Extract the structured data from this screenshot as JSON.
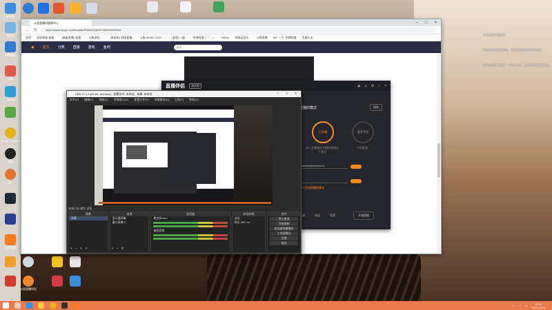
{
  "browser": {
    "tab_label": "斗鱼直播间管理中心",
    "url": "https://www.douyu.com/founder/Partner/Q4H/7/0023/2/0/2/0/6",
    "bookmarks": [
      "应用",
      "导航频道 极速...",
      "(高级直播) 极速...",
      "斗鱼游戏 - ...",
      "(发起的) 刚刚直播...",
      "斗鱼-MOBA 2345 - ...",
      "(游戏) 一起...",
      "哔哩哔哩 (゜-゜)...",
      "GitHub",
      "网易云音乐...",
      "斗鱼直播",
      "WE 一下, 你就知道",
      "百度大全"
    ],
    "site_nav": [
      "首页",
      "分类",
      "直播",
      "游戏",
      "鱼吧"
    ],
    "search_placeholder": "搜索"
  },
  "companion": {
    "title": "直播伴侣",
    "tag": "测试版",
    "mode_label": "直播的模式",
    "version_btn": "版本",
    "mode_a": "已开播",
    "mode_b": "直开平台",
    "mode_a_desc": "真人主播请在开播时选择这个模式",
    "mode_b_desc": "平台推流",
    "field_value": "●●●●●●●●●●●●●●●",
    "hint": "一个开始直播的模式",
    "bottom": [
      "推流",
      "画面",
      "设置",
      "开始直播"
    ]
  },
  "obs": {
    "title": "OBS 27.1.3 (64-bit, windows) - 配置文件: 未命名 - 场景: 未命名",
    "menu": [
      "文件(F)",
      "编辑(E)",
      "视图(V)",
      "停靠窗口(D)",
      "配置文件(P)",
      "场景集合(S)",
      "工具(T)",
      "帮助(H)"
    ],
    "control_label": "来源已选   属性   滤镜",
    "docks": {
      "scenes": {
        "header": "场景",
        "items": [
          "场景"
        ]
      },
      "sources": {
        "header": "来源",
        "items": [
          "显示器采集",
          "窗口采集 2"
        ]
      },
      "mixer": {
        "header": "混音器",
        "items": [
          "麦克风/Aux",
          "桌面音频"
        ]
      },
      "transitions": {
        "header": "转场特效",
        "items": [
          "淡出",
          "时长 300 ms"
        ]
      },
      "controls": {
        "header": "控件",
        "items": [
          "停止推流",
          "开始录制",
          "启动虚拟摄像机",
          "工作室模式",
          "设置",
          "退出"
        ]
      }
    }
  },
  "side_notes": [
    "关注主播不迷路哦",
    "开播前请先检查网络，设置好推流码再开始直播",
    "全屏显示时请检查一下窗口大小，如有问题请重新设置"
  ],
  "desktop_icons": [
    "此电脑",
    "回收站",
    "控制面板",
    "网络",
    "Steam",
    "Google Chrome",
    "微信",
    "QQ",
    "小鱼直播",
    "斗鱼直播伴侣"
  ],
  "taskbar": {
    "time": "15:03",
    "date": "2021/12/28"
  }
}
